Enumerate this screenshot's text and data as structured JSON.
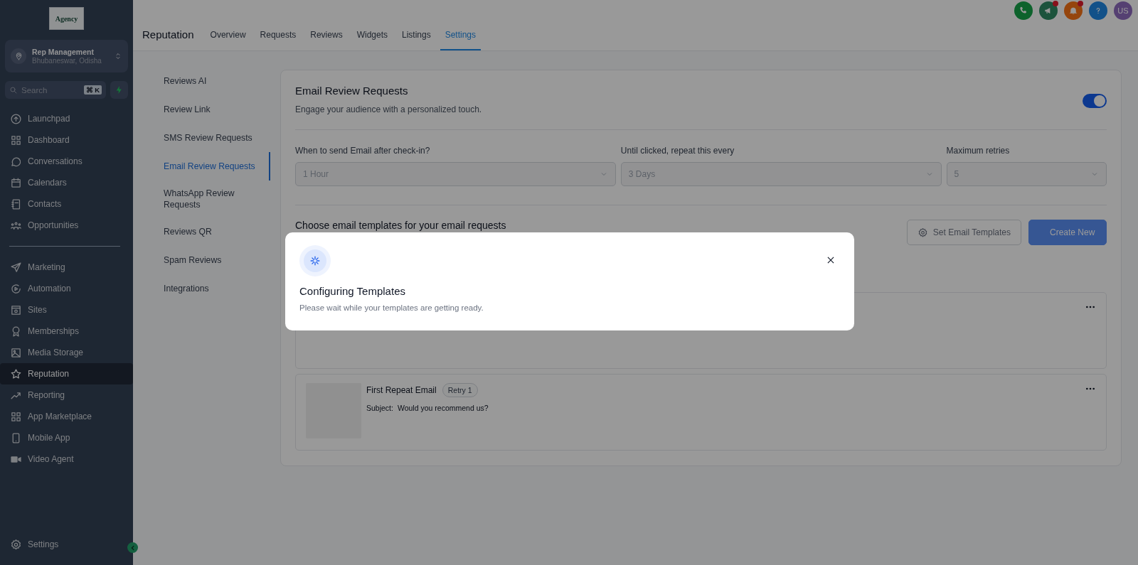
{
  "sidebar": {
    "logo": "Agency",
    "account": {
      "name": "Rep Management",
      "location": "Bhubaneswar, Odisha"
    },
    "search": {
      "placeholder": "Search",
      "shortcut": "⌘ K"
    },
    "groups": [
      {
        "items": [
          {
            "label": "Launchpad",
            "selected": false
          },
          {
            "label": "Dashboard",
            "selected": false
          },
          {
            "label": "Conversations",
            "selected": false
          },
          {
            "label": "Calendars",
            "selected": false
          },
          {
            "label": "Contacts",
            "selected": false
          },
          {
            "label": "Opportunities",
            "selected": false
          }
        ]
      },
      {
        "items": [
          {
            "label": "Marketing",
            "selected": false
          },
          {
            "label": "Automation",
            "selected": false
          },
          {
            "label": "Sites",
            "selected": false
          },
          {
            "label": "Memberships",
            "selected": false
          },
          {
            "label": "Media Storage",
            "selected": false
          },
          {
            "label": "Reputation",
            "selected": true
          },
          {
            "label": "Reporting",
            "selected": false
          },
          {
            "label": "App Marketplace",
            "selected": false
          },
          {
            "label": "Mobile App",
            "selected": false
          },
          {
            "label": "Video Agent",
            "selected": false
          }
        ]
      }
    ],
    "footer_item": "Settings"
  },
  "topbar": {
    "title": "Reputation",
    "tabs": [
      {
        "label": "Overview",
        "selected": false
      },
      {
        "label": "Requests",
        "selected": false
      },
      {
        "label": "Reviews",
        "selected": false
      },
      {
        "label": "Widgets",
        "selected": false
      },
      {
        "label": "Listings",
        "selected": false
      },
      {
        "label": "Settings",
        "selected": true
      }
    ],
    "actions": [
      {
        "kind": "phone",
        "badge": false
      },
      {
        "kind": "megaphone",
        "badge": true
      },
      {
        "kind": "bell",
        "badge": true
      },
      {
        "kind": "help",
        "badge": false
      }
    ],
    "avatar": "US"
  },
  "settings_nav": [
    {
      "label": "Reviews AI",
      "selected": false
    },
    {
      "label": "Review Link",
      "selected": false
    },
    {
      "label": "SMS Review Requests",
      "selected": false
    },
    {
      "label": "Email Review Requests",
      "selected": true
    },
    {
      "label": "WhatsApp Review Requests",
      "selected": false
    },
    {
      "label": "Reviews QR",
      "selected": false
    },
    {
      "label": "Spam Reviews",
      "selected": false
    },
    {
      "label": "Integrations",
      "selected": false
    }
  ],
  "card": {
    "title": "Email Review Requests",
    "description": "Engage your audience with a personalized touch.",
    "enabled": true,
    "fields": [
      {
        "label": "When to send Email after check-in?",
        "value": "1 Hour",
        "disabled": true
      },
      {
        "label": "Until clicked, repeat this every",
        "value": "3 Days",
        "disabled": true
      },
      {
        "label": "Maximum retries",
        "value": "5",
        "disabled": true
      }
    ],
    "section_title": "Choose email templates for your email requests",
    "buttons": [
      {
        "label": "Set Email Templates",
        "kind": "secondary"
      },
      {
        "label": "Create New",
        "kind": "primary"
      }
    ],
    "templates": [
      {
        "kind": "covered"
      },
      {
        "kind": "email",
        "name": "First Repeat Email",
        "tag": "Retry 1",
        "subject_label": "Subject:",
        "subject": "Would you recommend us?"
      }
    ]
  },
  "modal": {
    "title": "Configuring Templates",
    "message": "Please wait while your templates are getting ready."
  }
}
